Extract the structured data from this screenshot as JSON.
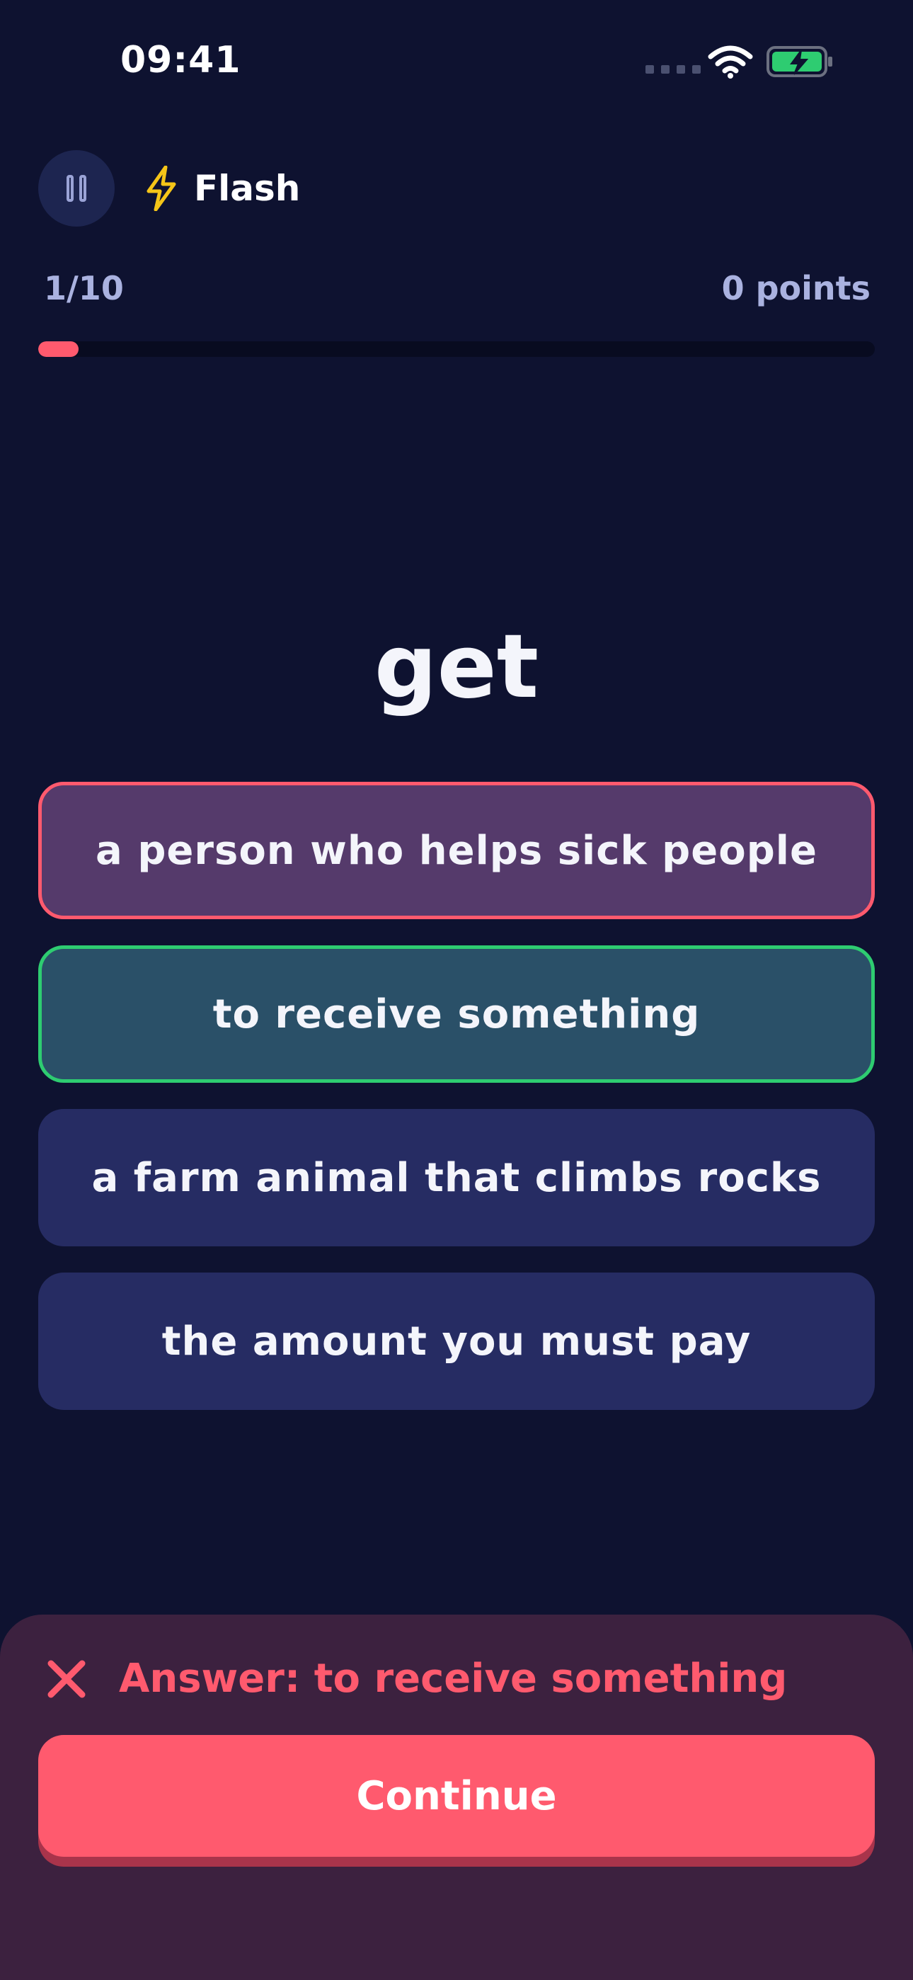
{
  "status_bar": {
    "time": "09:41"
  },
  "header": {
    "mode_label": "Flash",
    "pause_icon": "pause-icon",
    "mode_icon": "lightning-bolt-icon"
  },
  "progress": {
    "count_text": "1/10",
    "points_text": "0 points",
    "fraction": 0.1
  },
  "question": {
    "word": "get"
  },
  "options": [
    {
      "text": "a person who helps sick people",
      "state": "wrong"
    },
    {
      "text": "to receive something",
      "state": "correct"
    },
    {
      "text": "a farm animal that climbs rocks",
      "state": "default"
    },
    {
      "text": "the amount you must pay",
      "state": "default"
    }
  ],
  "feedback": {
    "answer_text": "Answer: to receive something",
    "icon": "close-icon",
    "continue_label": "Continue"
  },
  "colors": {
    "background": "#0e1230",
    "accent_red": "#ff5a6e",
    "correct_green": "#2ecc71",
    "option_bg": "#262c63"
  }
}
